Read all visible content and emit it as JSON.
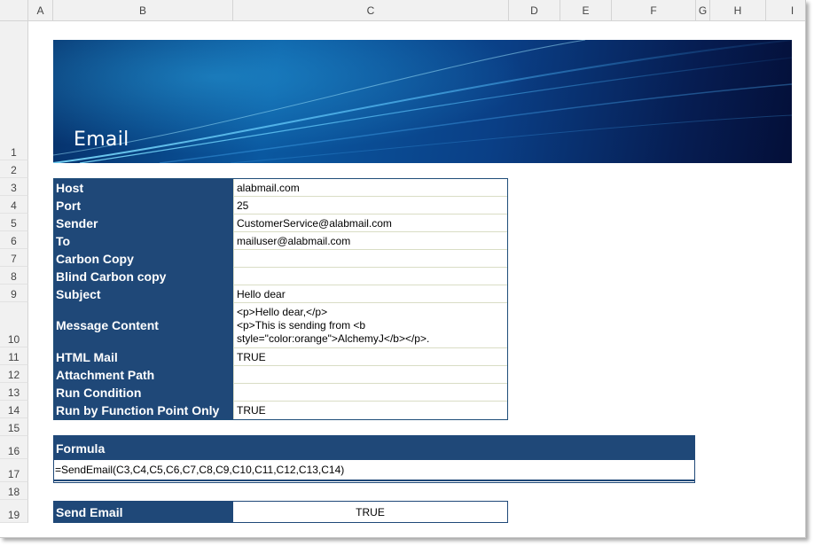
{
  "columns": [
    "A",
    "B",
    "C",
    "D",
    "E",
    "F",
    "G",
    "H",
    "I"
  ],
  "rows": [
    "1",
    "2",
    "3",
    "4",
    "5",
    "6",
    "7",
    "8",
    "9",
    "10",
    "11",
    "12",
    "13",
    "14",
    "15",
    "16",
    "17",
    "18",
    "19"
  ],
  "banner": {
    "title": "Email"
  },
  "fields": [
    {
      "label": "Host",
      "value": "alabmail.com"
    },
    {
      "label": "Port",
      "value": "25"
    },
    {
      "label": "Sender",
      "value": "CustomerService@alabmail.com"
    },
    {
      "label": "To",
      "value": "mailuser@alabmail.com"
    },
    {
      "label": "Carbon Copy",
      "value": ""
    },
    {
      "label": "Blind Carbon copy",
      "value": ""
    },
    {
      "label": "Subject",
      "value": "Hello dear"
    },
    {
      "label": "Message Content",
      "value_lines": [
        "<p>Hello dear,</p>",
        "<p>This is sending from <b",
        "style=\"color:orange\">AlchemyJ</b></p>."
      ]
    },
    {
      "label": "HTML Mail",
      "value": "TRUE"
    },
    {
      "label": "Attachment Path",
      "value": ""
    },
    {
      "label": "Run Condition",
      "value": ""
    },
    {
      "label": "Run by Function Point Only",
      "value": "TRUE"
    }
  ],
  "formula": {
    "label": "Formula",
    "value": "=SendEmail(C3,C4,C5,C6,C7,C8,C9,C10,C11,C12,C13,C14)"
  },
  "send": {
    "label": "Send Email",
    "value": "TRUE"
  }
}
